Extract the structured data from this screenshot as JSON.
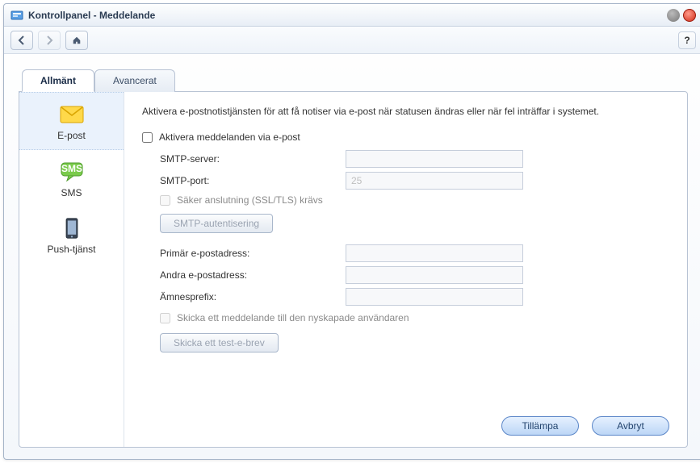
{
  "window": {
    "title": "Kontrollpanel - Meddelande"
  },
  "tabs": {
    "general": "Allmänt",
    "advanced": "Avancerat"
  },
  "sidebar": {
    "email": "E-post",
    "sms": "SMS",
    "push": "Push-tjänst"
  },
  "main": {
    "intro": "Aktivera e-postnotistjänsten för att få notiser via e-post när statusen ändras eller när fel inträffar i systemet.",
    "enable_email": "Aktivera meddelanden via e-post",
    "smtp_server": "SMTP-server:",
    "smtp_port": "SMTP-port:",
    "smtp_port_value": "25",
    "ssl_required": "Säker anslutning (SSL/TLS) krävs",
    "smtp_auth_btn": "SMTP-autentisering",
    "primary_email": "Primär e-postadress:",
    "secondary_email": "Andra e-postadress:",
    "subject_prefix": "Ämnesprefix:",
    "send_new_user": "Skicka ett meddelande till den nyskapade användaren",
    "test_mail_btn": "Skicka ett test-e-brev"
  },
  "buttons": {
    "apply": "Tillämpa",
    "cancel": "Avbryt"
  }
}
